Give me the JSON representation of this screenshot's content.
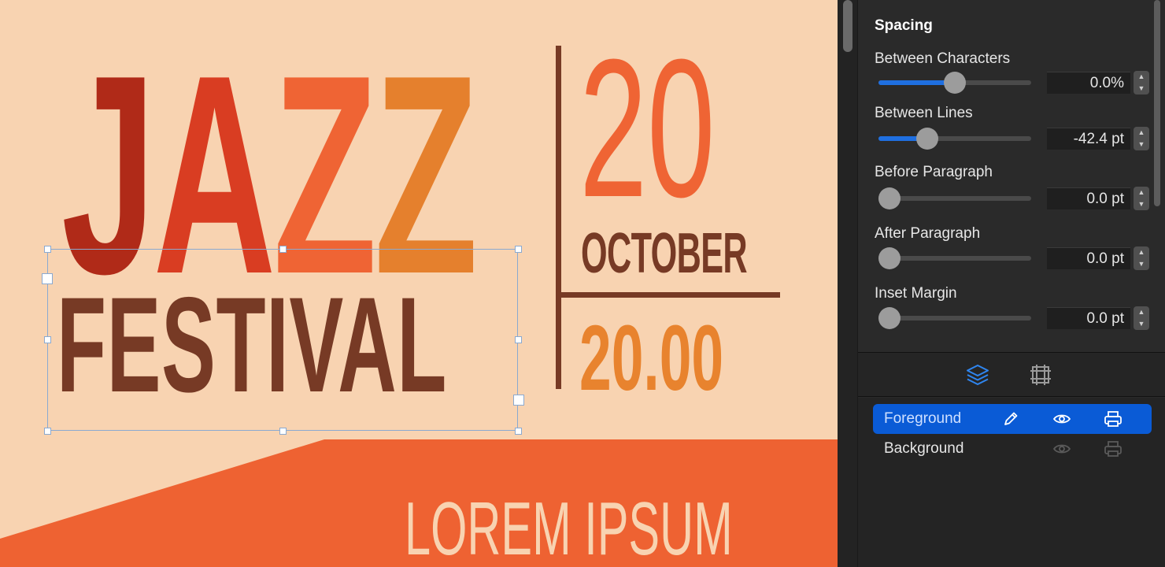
{
  "poster": {
    "jazz_letters": [
      {
        "char": "J",
        "color": "#b02a18"
      },
      {
        "char": "A",
        "color": "#d93d22"
      },
      {
        "char": "Z",
        "color": "#ef6434"
      },
      {
        "char": "Z",
        "color": "#e5802d"
      }
    ],
    "festival": "FESTIVAL",
    "day": "20",
    "month": "OCTOBER",
    "time": "20.00",
    "tagline": "LOREM IPSUM",
    "colors": {
      "background": "#f8d3b1",
      "band": "#ee6232",
      "brown": "#773a25"
    }
  },
  "panel": {
    "section_title": "Spacing",
    "controls": [
      {
        "label": "Between Characters",
        "value": "0.0%",
        "fill": 0.5
      },
      {
        "label": "Between Lines",
        "value": "-42.4 pt",
        "fill": 0.32
      },
      {
        "label": "Before Paragraph",
        "value": "0.0 pt",
        "fill": 0.0
      },
      {
        "label": "After Paragraph",
        "value": "0.0 pt",
        "fill": 0.0
      },
      {
        "label": "Inset Margin",
        "value": "0.0 pt",
        "fill": 0.0
      }
    ],
    "tabs": [
      {
        "icon": "layers-icon",
        "active": true
      },
      {
        "icon": "grid-icon",
        "active": false
      }
    ],
    "layers": [
      {
        "name": "Foreground",
        "selected": true
      },
      {
        "name": "Background",
        "selected": false
      }
    ],
    "accent": "#0a5bd6"
  }
}
